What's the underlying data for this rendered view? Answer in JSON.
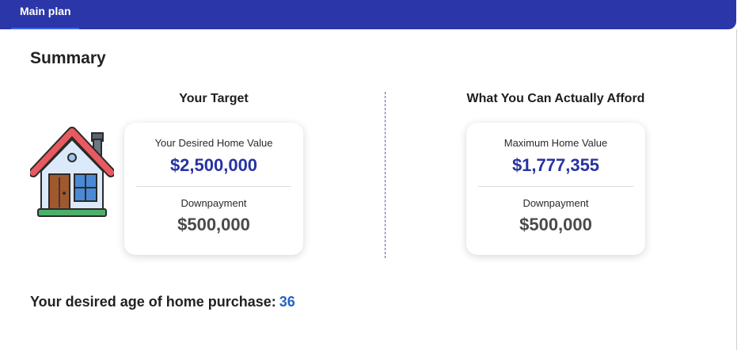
{
  "tabs": [
    {
      "label": "Main plan"
    }
  ],
  "summary": {
    "title": "Summary"
  },
  "target": {
    "heading": "Your Target",
    "home_value_label": "Your Desired Home Value",
    "home_value": "$2,500,000",
    "downpayment_label": "Downpayment",
    "downpayment": "$500,000"
  },
  "afford": {
    "heading": "What You Can Actually Afford",
    "home_value_label": "Maximum Home Value",
    "home_value": "$1,777,355",
    "downpayment_label": "Downpayment",
    "downpayment": "$500,000"
  },
  "age": {
    "label": "Your desired age of home purchase:",
    "value": "36"
  },
  "icons": {
    "house": "house-icon"
  },
  "colors": {
    "topbar": "#2b36a8",
    "primary_value": "#2733a2",
    "age_value": "#2563c7"
  }
}
